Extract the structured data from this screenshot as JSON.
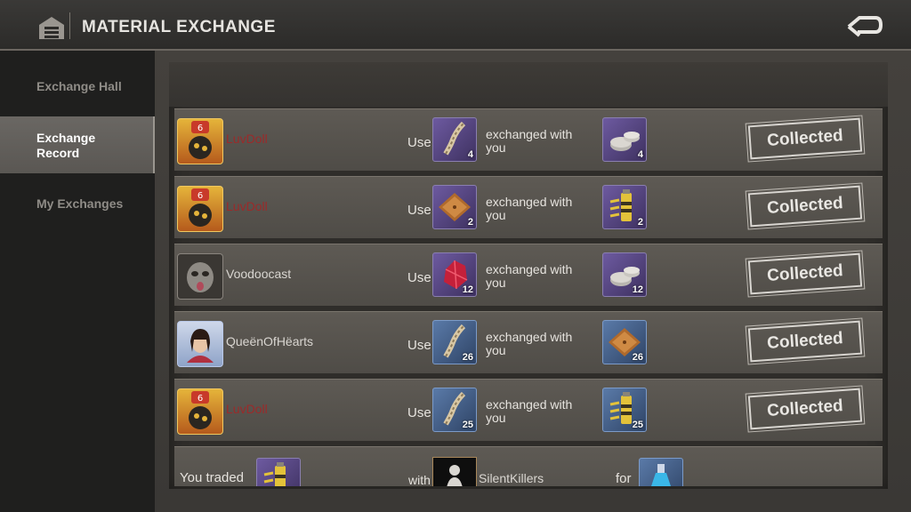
{
  "header": {
    "title": "MATERIAL EXCHANGE"
  },
  "sidebar": {
    "items": [
      {
        "label": "Exchange Hall",
        "active": false
      },
      {
        "label": "Exchange Record",
        "active": true
      },
      {
        "label": "My Exchanges",
        "active": false
      }
    ]
  },
  "records": [
    {
      "name": "LuvDoll",
      "name_color": "red",
      "use_label": "Use",
      "give_item": "rope",
      "give_qty": "4",
      "exchanged_text": "exchanged with you",
      "get_item": "nuts",
      "get_qty": "4",
      "status": "Collected"
    },
    {
      "name": "LuvDoll",
      "name_color": "red",
      "use_label": "Use",
      "give_item": "wood-plank",
      "give_qty": "2",
      "exchanged_text": "exchanged with you",
      "get_item": "battery",
      "get_qty": "2",
      "status": "Collected"
    },
    {
      "name": "Voodoocast",
      "name_color": "normal",
      "use_label": "Use",
      "give_item": "ruby",
      "give_qty": "12",
      "exchanged_text": "exchanged with you",
      "get_item": "nuts",
      "get_qty": "12",
      "status": "Collected"
    },
    {
      "name": "QueënOfHëarts",
      "name_color": "normal",
      "use_label": "Use",
      "give_item": "rope",
      "give_qty": "26",
      "exchanged_text": "exchanged with you",
      "get_item": "wood-plank",
      "get_qty": "26",
      "status": "Collected"
    },
    {
      "name": "LuvDoll",
      "name_color": "red",
      "use_label": "Use",
      "give_item": "rope",
      "give_qty": "25",
      "exchanged_text": "exchanged with you",
      "get_item": "battery",
      "get_qty": "25",
      "status": "Collected"
    }
  ],
  "trade": {
    "you_traded": "You traded",
    "with": "with",
    "partner": "SilentKillers",
    "for": "for"
  }
}
